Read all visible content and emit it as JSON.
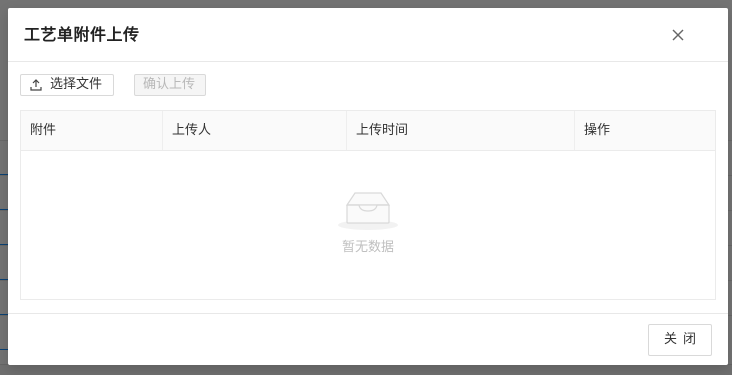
{
  "modal": {
    "title": "工艺单附件上传",
    "select_file_label": "选择文件",
    "confirm_upload_label": "确认上传",
    "close_label": "关闭"
  },
  "table": {
    "columns": [
      "附件",
      "上传人",
      "上传时间",
      "操作"
    ],
    "empty_text": "暂无数据"
  },
  "colors": {
    "disabled_bg": "#f5f5f5",
    "disabled_text": "#b8b8b8",
    "header_bg": "#fafafa",
    "link_blue": "#1890ff"
  }
}
